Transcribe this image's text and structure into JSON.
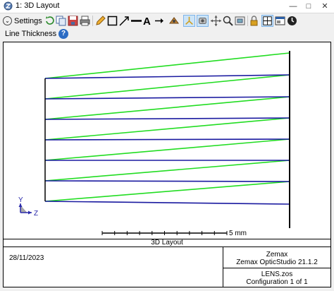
{
  "window": {
    "title": "1: 3D Layout",
    "minimize": "—",
    "maximize": "□",
    "close": "✕"
  },
  "toolbar": {
    "settings_label": "Settings",
    "line_thickness_label": "Line Thickness",
    "icons": [
      "refresh-icon",
      "copy-icon",
      "save-icon",
      "print-icon",
      "pencil-icon",
      "rectangle-icon",
      "arrow-icon",
      "line-icon",
      "text-icon",
      "arrow-small-icon",
      "rotate-icon",
      "axes-icon",
      "rotate-view-icon",
      "pan-icon",
      "zoom-icon",
      "zoom-window-icon",
      "lock-icon",
      "layout-icon",
      "window-icon",
      "clock-icon"
    ]
  },
  "plot": {
    "scale_label": "5 mm",
    "axis_labels": {
      "y": "Y",
      "z": "Z"
    },
    "colors": {
      "green": "#22dd22",
      "blue": "#1a1aa0",
      "lens": "#000000"
    }
  },
  "titleblock": {
    "heading": "3D Layout",
    "date": "28/11/2023",
    "company": "Zemax",
    "product": "Zemax OpticStudio 21.1.2",
    "file": "LENS.zos",
    "configuration": "Configuration 1 of 1"
  }
}
